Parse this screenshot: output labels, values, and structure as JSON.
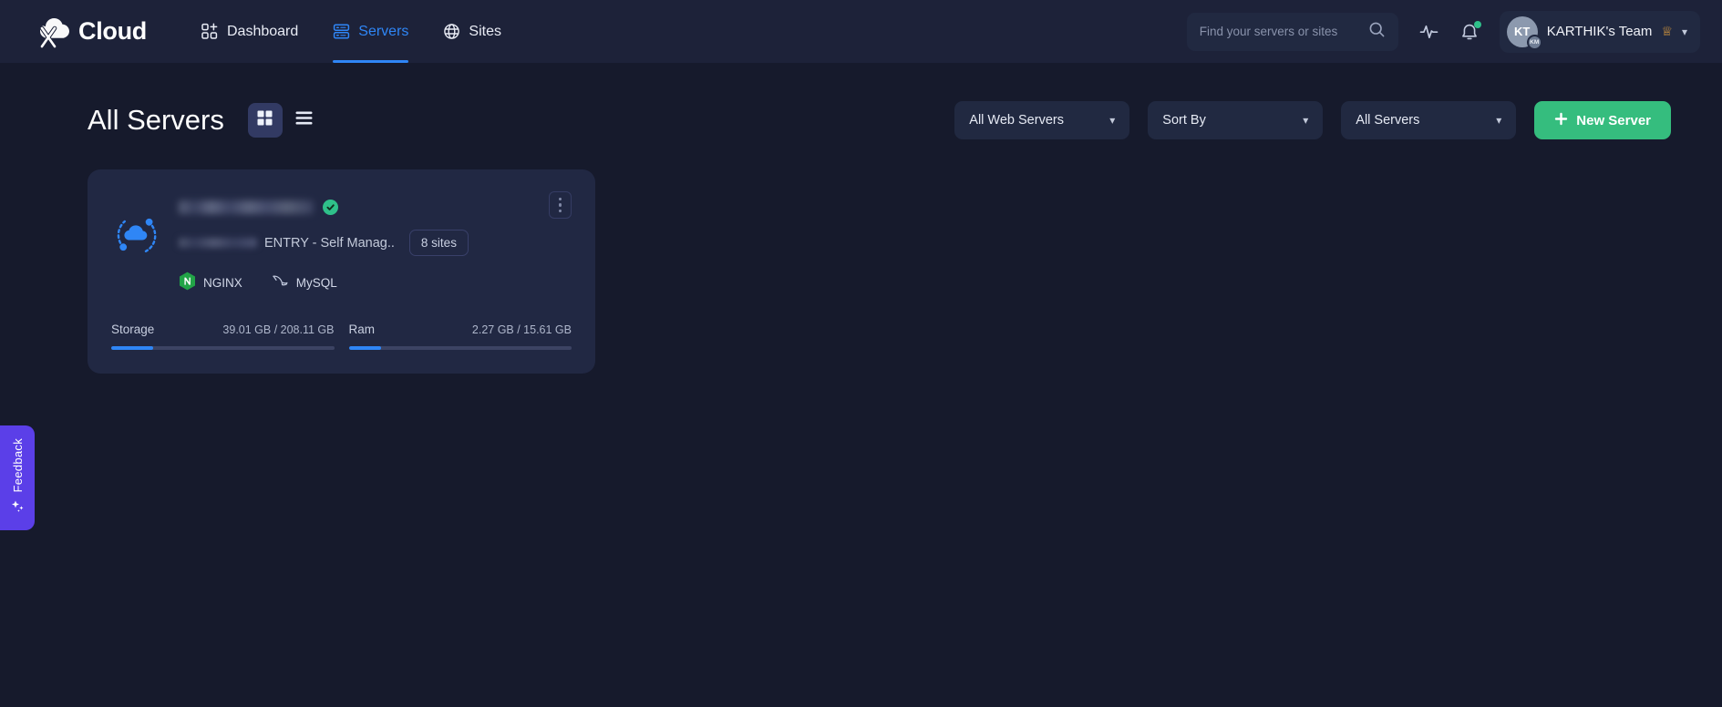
{
  "header": {
    "brand": "Cloud",
    "nav": [
      {
        "label": "Dashboard",
        "icon": "grid-plus-icon",
        "active": false
      },
      {
        "label": "Servers",
        "icon": "server-rack-icon",
        "active": true
      },
      {
        "label": "Sites",
        "icon": "globe-icon",
        "active": false
      }
    ],
    "search": {
      "placeholder": "Find your servers or sites",
      "value": "",
      "icon": "search-icon"
    },
    "activity_icon": "activity-pulse-icon",
    "notifications_icon": "bell-icon",
    "notification_dot": true,
    "account": {
      "avatar_initials": "KT",
      "avatar_badge_initials": "KM",
      "team_name": "KARTHIK's Team",
      "crown_icon": "crown-icon",
      "chevron_icon": "chevron-down-icon"
    }
  },
  "toolbar": {
    "title": "All Servers",
    "view_modes": [
      {
        "name": "grid",
        "icon": "grid-view-icon",
        "active": true
      },
      {
        "name": "list",
        "icon": "list-view-icon",
        "active": false
      }
    ],
    "filters": [
      {
        "name": "web-server-filter",
        "label": "All Web Servers"
      },
      {
        "name": "sort-by",
        "label": "Sort By"
      },
      {
        "name": "server-scope-filter",
        "label": "All Servers"
      }
    ],
    "new_server_button": {
      "label": "New Server",
      "icon": "plus-icon",
      "color": "#35bd7e"
    }
  },
  "servers": [
    {
      "name_redacted": true,
      "status_icon": "check-circle-icon",
      "status_color": "#2fc08a",
      "ip_redacted": true,
      "plan": "ENTRY - Self Manag..",
      "sites_badge": "8 sites",
      "server_icon": "cloud-orbit-icon",
      "menu_icon": "kebab-menu-icon",
      "tech": [
        {
          "label": "NGINX",
          "icon": "nginx-icon"
        },
        {
          "label": "MySQL",
          "icon": "mysql-dolphin-icon"
        }
      ],
      "stats": [
        {
          "label": "Storage",
          "value": "39.01 GB / 208.11 GB",
          "percent": 18.7,
          "color": "#2f86f6"
        },
        {
          "label": "Ram",
          "value": "2.27 GB / 15.61 GB",
          "percent": 14.5,
          "color": "#2f86f6"
        }
      ]
    }
  ],
  "feedback": {
    "label": "Feedback",
    "icon": "sparkle-icon",
    "color": "#5b3fe8"
  }
}
